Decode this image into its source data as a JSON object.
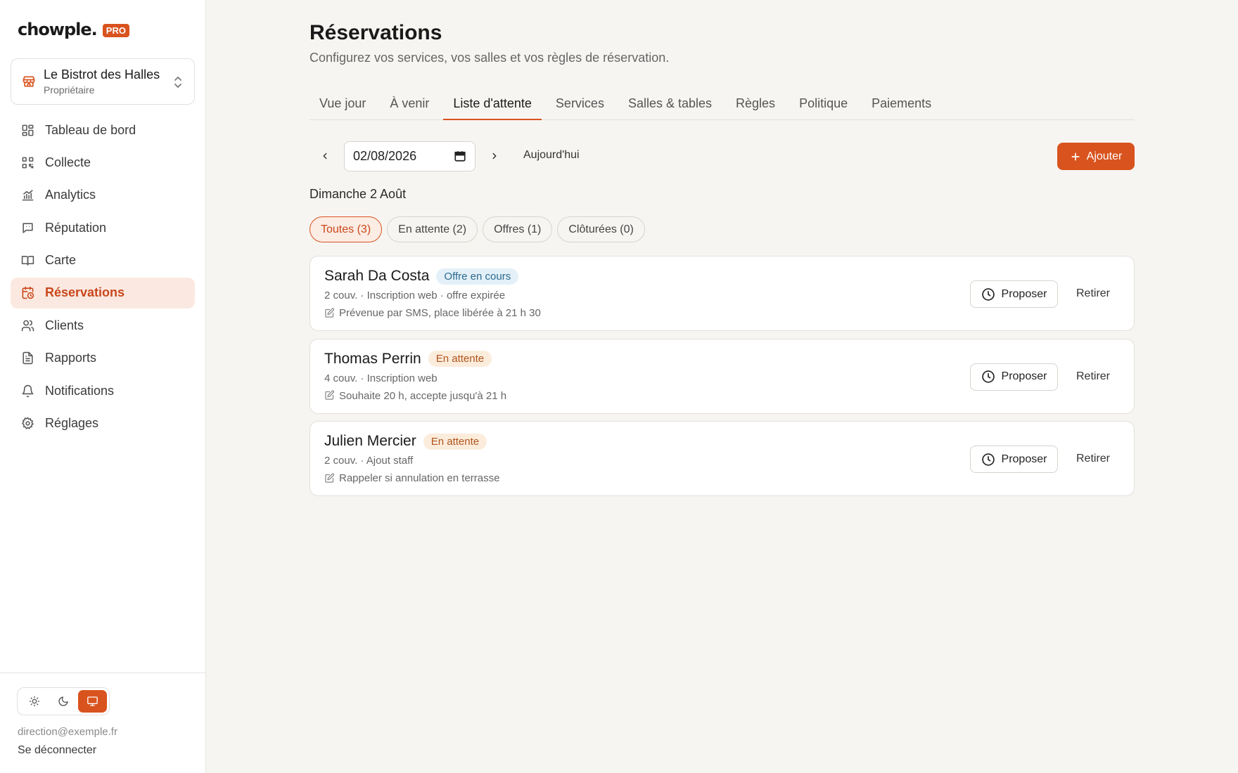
{
  "brand": {
    "name": "chowple.",
    "badge": "PRO"
  },
  "org": {
    "name": "Le Bistrot des Halles",
    "role": "Propriétaire"
  },
  "nav": [
    {
      "label": "Tableau de bord",
      "icon": "dashboard-icon"
    },
    {
      "label": "Collecte",
      "icon": "qr-code-icon"
    },
    {
      "label": "Analytics",
      "icon": "chart-icon"
    },
    {
      "label": "Réputation",
      "icon": "message-icon"
    },
    {
      "label": "Carte",
      "icon": "book-icon"
    },
    {
      "label": "Réservations",
      "icon": "calendar-clock-icon",
      "active": true
    },
    {
      "label": "Clients",
      "icon": "users-icon"
    },
    {
      "label": "Rapports",
      "icon": "file-icon"
    },
    {
      "label": "Notifications",
      "icon": "bell-icon"
    },
    {
      "label": "Réglages",
      "icon": "gear-icon"
    }
  ],
  "footer": {
    "email": "direction@exemple.fr",
    "logout": "Se déconnecter",
    "theme_active": "system"
  },
  "page": {
    "title": "Réservations",
    "subtitle": "Configurez vos services, vos salles et vos règles de réservation."
  },
  "tabs": [
    {
      "label": "Vue jour"
    },
    {
      "label": "À venir"
    },
    {
      "label": "Liste d'attente",
      "active": true
    },
    {
      "label": "Services"
    },
    {
      "label": "Salles & tables"
    },
    {
      "label": "Règles"
    },
    {
      "label": "Politique"
    },
    {
      "label": "Paiements"
    }
  ],
  "toolbar": {
    "date": "02/08/2026",
    "today": "Aujourd'hui",
    "add": "Ajouter"
  },
  "day_label": "Dimanche 2 Août",
  "filters": [
    {
      "label": "Toutes (3)",
      "active": true
    },
    {
      "label": "En attente (2)"
    },
    {
      "label": "Offres (1)"
    },
    {
      "label": "Clôturées (0)"
    }
  ],
  "entries": [
    {
      "name": "Sarah Da Costa",
      "status": "Offre en cours",
      "status_type": "offer",
      "meta": "2 couv. · Inscription web · offre expirée",
      "note": "Prévenue par SMS, place libérée à 21 h 30",
      "propose": "Proposer",
      "remove": "Retirer"
    },
    {
      "name": "Thomas Perrin",
      "status": "En attente",
      "status_type": "wait",
      "meta": "4 couv. · Inscription web",
      "note": "Souhaite 20 h, accepte jusqu'à 21 h",
      "propose": "Proposer",
      "remove": "Retirer"
    },
    {
      "name": "Julien Mercier",
      "status": "En attente",
      "status_type": "wait",
      "meta": "2 couv. · Ajout staff",
      "note": "Rappeler si annulation en terrasse",
      "propose": "Proposer",
      "remove": "Retirer"
    }
  ],
  "colors": {
    "accent": "#d9531e",
    "active_bg": "#fbe9e1",
    "offer_bg": "#e3f0f8",
    "wait_bg": "#fbecdc"
  }
}
